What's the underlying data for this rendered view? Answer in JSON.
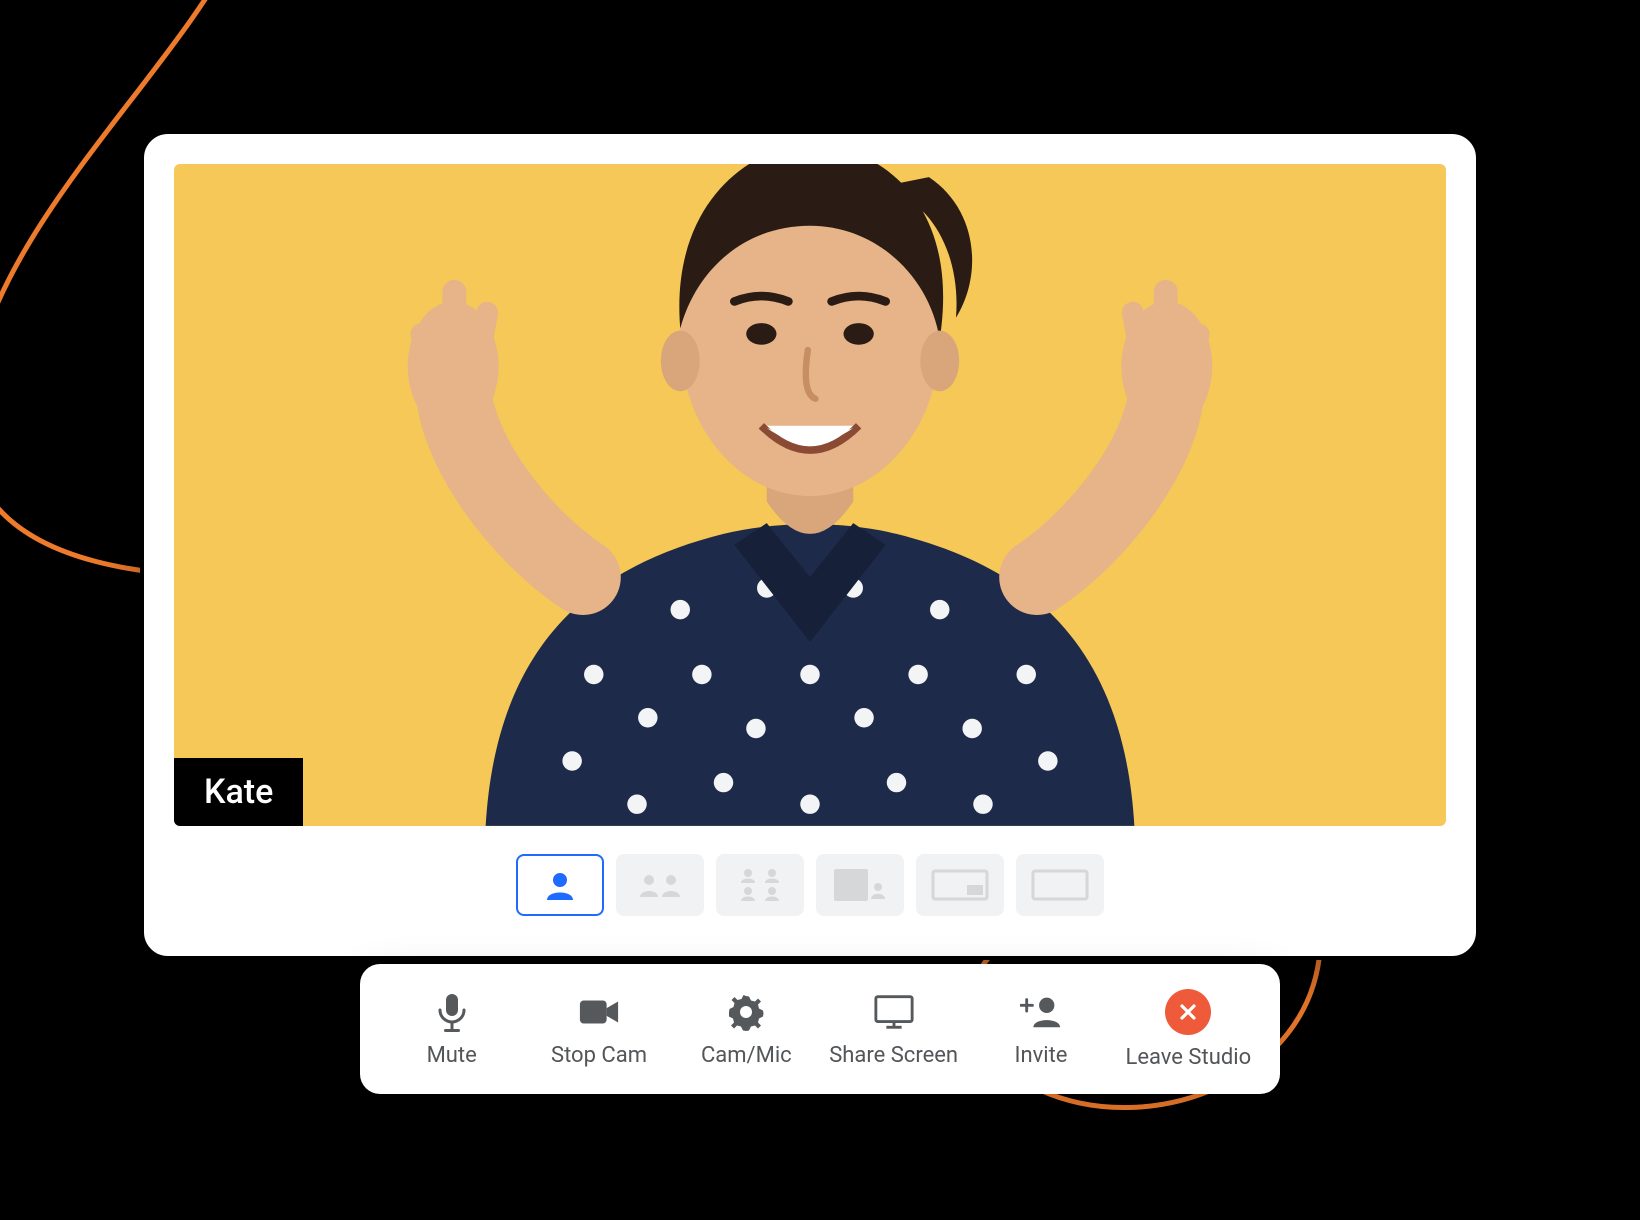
{
  "participant": {
    "name": "Kate"
  },
  "layouts": {
    "active_index": 0,
    "count": 6
  },
  "toolbar": {
    "mute": "Mute",
    "stop_cam": "Stop Cam",
    "cam_mic": "Cam/Mic",
    "share_screen": "Share Screen",
    "invite": "Invite",
    "leave": "Leave Studio"
  },
  "colors": {
    "accent": "#1f6bff",
    "video_bg": "#f5c857",
    "leave": "#ee5a3a",
    "swirl": "#ee7a2b"
  }
}
